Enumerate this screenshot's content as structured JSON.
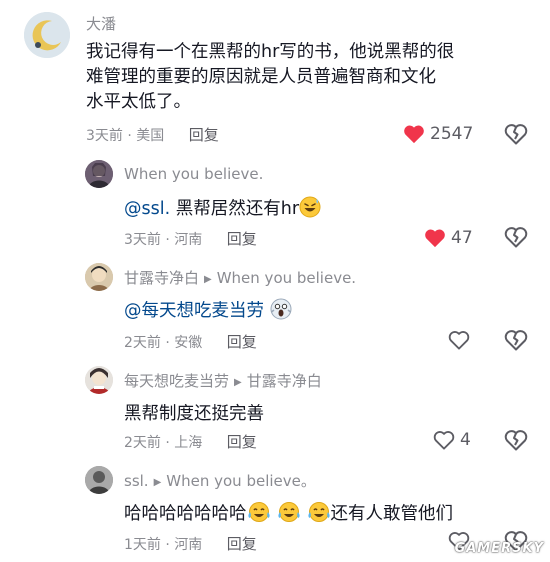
{
  "comments": [
    {
      "author": "大潘",
      "text": "我记得有一个在黑帮的hr写的书，他说黑帮的很难管理的重要的原因就是人员普遍智商和文化水平太低了。",
      "text_lines": [
        "我记得有一个在黑帮的hr写的书，他说黑帮的很",
        "难管理的重要的原因就是人员普遍智商和文化",
        "水平太低了。"
      ],
      "time": "3天前",
      "location": "美国",
      "reply_label": "回复",
      "likes": "2547",
      "liked": true
    },
    {
      "author": "When you believe.",
      "mention": "@ssl.",
      "text": "黑帮居然还有hr",
      "time": "3天前",
      "location": "河南",
      "reply_label": "回复",
      "likes": "47",
      "liked": true
    },
    {
      "author": "甘露寺净白",
      "reply_to": "When you believe.",
      "mention": "@每天想吃麦当劳",
      "time": "2天前",
      "location": "安徽",
      "reply_label": "回复",
      "likes": "",
      "liked": false
    },
    {
      "author": "每天想吃麦当劳",
      "reply_to": "甘露寺净白",
      "text": "黑帮制度还挺完善",
      "time": "2天前",
      "location": "上海",
      "reply_label": "回复",
      "likes": "4",
      "liked": false
    },
    {
      "author": "ssl.",
      "reply_to": "When you believe。",
      "text_before": "哈哈哈哈哈哈哈",
      "text_after": "还有人敢管他们",
      "time": "1天前",
      "location": "河南",
      "reply_label": "回复",
      "likes": "",
      "liked": false
    }
  ],
  "meta_separator": " · ",
  "icons": {
    "like": "heart-icon",
    "dislike": "broken-heart-icon",
    "reply_arrow": "triangle-right-icon"
  },
  "colors": {
    "liked_heart": "#f0354b",
    "outline_icon": "#5c5c63",
    "secondary_text": "#8a8b91",
    "mention": "#04498d"
  },
  "watermark": "GAMERSKY"
}
